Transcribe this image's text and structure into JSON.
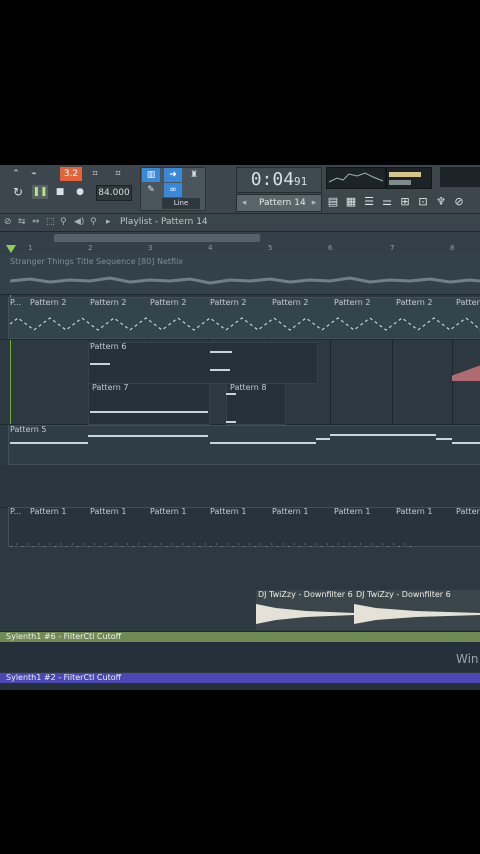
{
  "toolbar": {
    "time_main": "0:04",
    "time_ms": "91",
    "pattern_selector": "Pattern 14",
    "tempo": "84.000",
    "step_badge": "3.2",
    "line_mode": "Line"
  },
  "playlist": {
    "title": "Playlist - Pattern 14",
    "bar_numbers": [
      "1",
      "2",
      "3",
      "4",
      "5",
      "6",
      "7",
      "8"
    ]
  },
  "tracks": {
    "audio_title": "Stranger Things Title Sequence [80] Netflix",
    "pattern2_first": "P...",
    "pattern2_label": "Pattern 2",
    "pattern6_label": "Pattern 6",
    "pattern7_label": "Pattern 7",
    "pattern8_label": "Pattern 8",
    "pattern5_label": "Pattern 5",
    "pattern1_first": "P...",
    "pattern1_label": "Pattern 1",
    "downfilter_label": "DJ TwiZzy - Downfilter 6",
    "auto1": "Sylenth1 #6 - FilterCtl Cutoff",
    "auto2": "Sylenth1 #2 - FilterCtl Cutoff"
  },
  "watermark": "Win",
  "colors": {
    "timeline_bg": "#2c3940",
    "auto_green": "#6f8a52",
    "auto_blue": "#4a48b4",
    "step_badge": "#e2643a"
  },
  "icons": [
    "play-icon",
    "pause-icon",
    "stop-icon",
    "record-icon",
    "metronome-icon",
    "search-icon",
    "speaker-icon",
    "snap-icon"
  ]
}
